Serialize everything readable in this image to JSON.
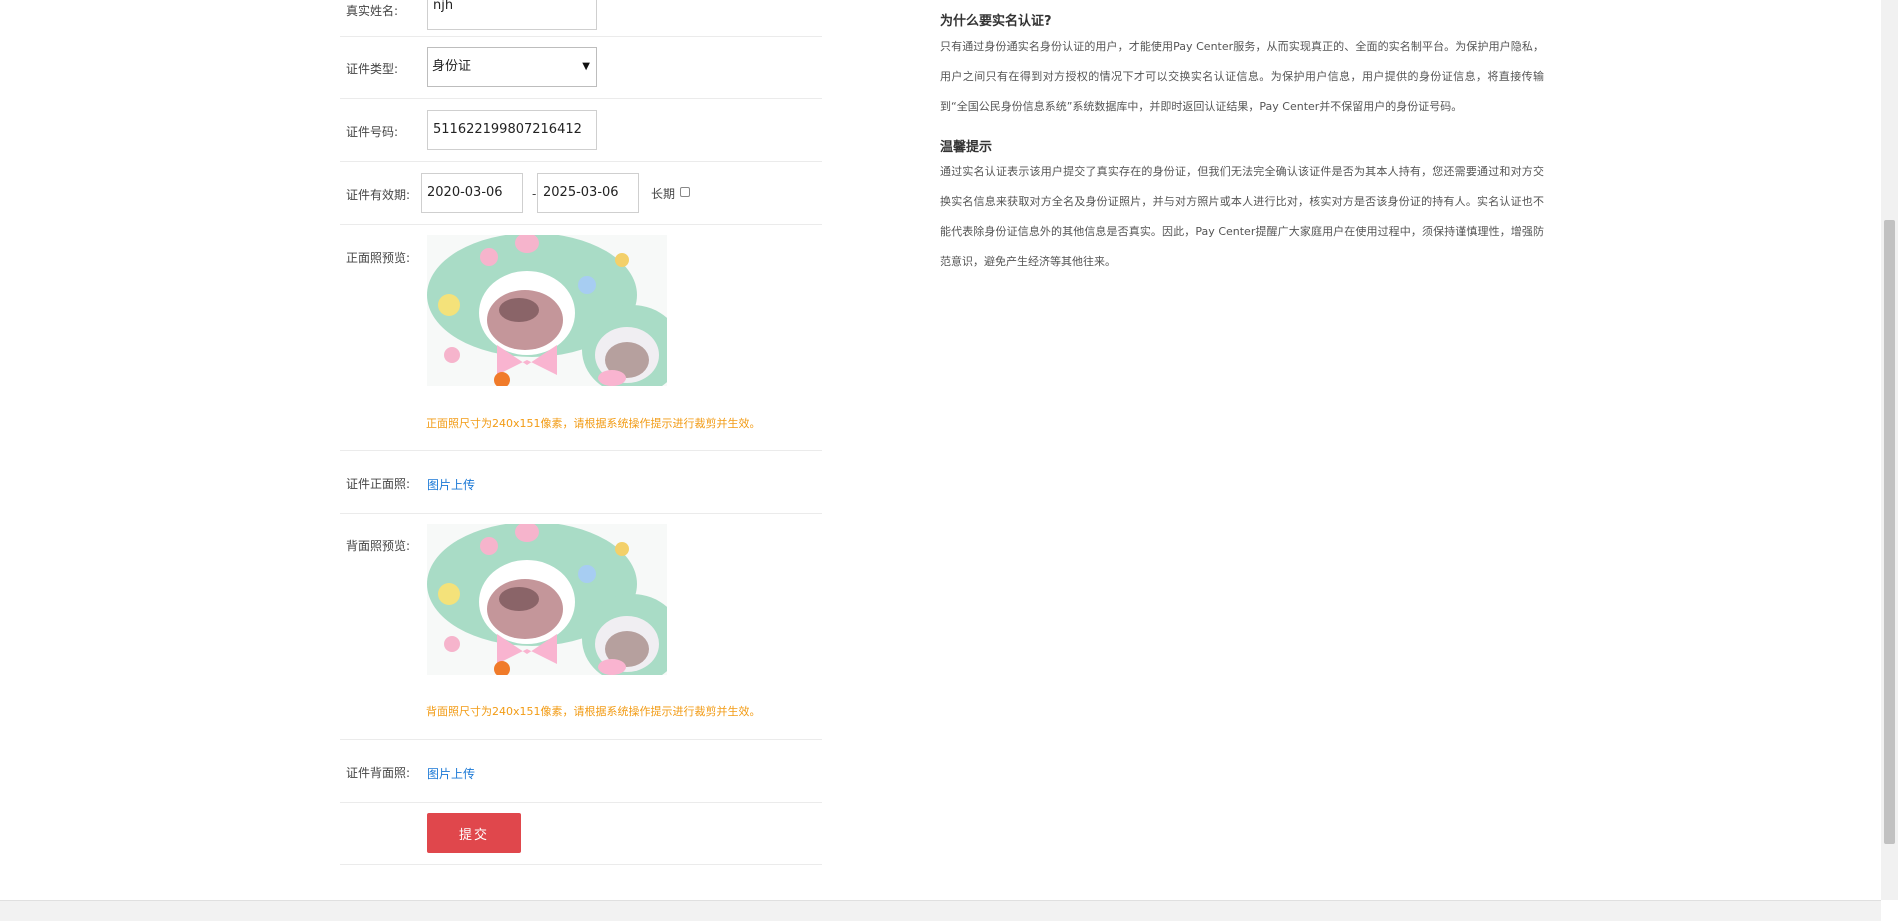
{
  "form": {
    "real_name": {
      "label": "真实姓名:",
      "value": "njh"
    },
    "id_type": {
      "label": "证件类型:",
      "selected": "身份证"
    },
    "id_number": {
      "label": "证件号码:",
      "value": "511622199807216412"
    },
    "validity": {
      "label": "证件有效期:",
      "start": "2020-03-06",
      "separator": "-",
      "end": "2025-03-06",
      "long_term_label": "长期",
      "long_term_checked": false
    },
    "front_preview": {
      "label": "正面照预览:",
      "hint": "正面照尺寸为240x151像素，请根据系统操作提示进行裁剪并生效。"
    },
    "front_upload": {
      "label": "证件正面照:",
      "link": "图片上传"
    },
    "back_preview": {
      "label": "背面照预览:",
      "hint": "背面照尺寸为240x151像素，请根据系统操作提示进行裁剪并生效。"
    },
    "back_upload": {
      "label": "证件背面照:",
      "link": "图片上传"
    },
    "submit_label": "提交"
  },
  "info": {
    "why_title": "为什么要实名认证?",
    "why_text": "只有通过身份通实名身份认证的用户，才能使用Pay Center服务，从而实现真正的、全面的实名制平台。为保护用户隐私，用户之间只有在得到对方授权的情况下才可以交换实名认证信息。为保护用户信息，用户提供的身份证信息，将直接传输到“全国公民身份信息系统”系统数据库中，并即时返回认证结果，Pay Center并不保留用户的身份证号码。",
    "tips_title": "温馨提示",
    "tips_text": "通过实名认证表示该用户提交了真实存在的身份证，但我们无法完全确认该证件是否为其本人持有，您还需要通过和对方交换实名信息来获取对方全名及身份证照片，并与对方照片或本人进行比对，核实对方是否该身份证的持有人。实名认证也不能代表除身份证信息外的其他信息是否真实。因此，Pay Center提醒广大家庭用户在使用过程中，须保持谨慎理性，增强防范意识，避免产生经济等其他往来。"
  },
  "colors": {
    "submit_bg": "#e0474c",
    "hint_text": "#f29b14",
    "link_text": "#1a78d6"
  }
}
